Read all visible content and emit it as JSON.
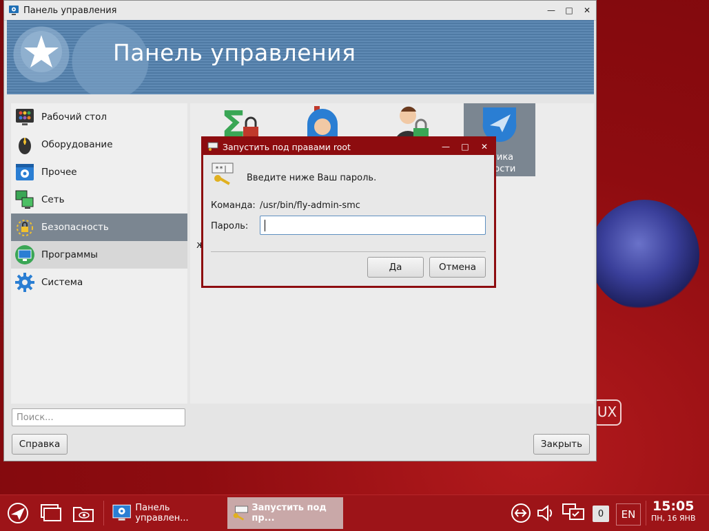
{
  "main_window": {
    "title": "Панель управления",
    "banner_title": "Панель управления",
    "sidebar": [
      {
        "label": "Рабочий стол",
        "icon": "desktop-icon"
      },
      {
        "label": "Оборудование",
        "icon": "mouse-icon"
      },
      {
        "label": "Прочее",
        "icon": "window-gear-icon"
      },
      {
        "label": "Сеть",
        "icon": "network-icon"
      },
      {
        "label": "Безопасность",
        "icon": "security-lock-icon",
        "selected": true
      },
      {
        "label": "Программы",
        "icon": "monitor-icon"
      },
      {
        "label": "Система",
        "icon": "gear-icon"
      }
    ],
    "content_tiles": [
      {
        "icon": "sigma-lock-icon"
      },
      {
        "icon": "user-badge-icon"
      },
      {
        "icon": "user-lock-icon"
      },
      {
        "icon": "policy-shield-icon",
        "label_line1": "итика",
        "label_line2": "сности"
      }
    ],
    "stray_char": "ж",
    "search_placeholder": "Поиск...",
    "help_button": "Справка",
    "close_button": "Закрыть"
  },
  "dialog": {
    "title": "Запустить под правами root",
    "prompt": "Введите ниже Ваш пароль.",
    "command_label": "Команда:",
    "command_value": "/usr/bin/fly-admin-smc",
    "password_label": "Пароль:",
    "password_value": "",
    "ok_button": "Да",
    "cancel_button": "Отмена"
  },
  "desktop": {
    "logo_text": "UX"
  },
  "taskbar": {
    "tasks": [
      {
        "label": "Панель управлен...",
        "icon": "control-panel-icon"
      },
      {
        "label": "Запустить под пр...",
        "icon": "keys-icon",
        "active": true
      }
    ],
    "tray": {
      "notifications_count": "0",
      "keyboard_layout": "EN",
      "time": "15:05",
      "date": "ПН, 16 ЯНВ"
    }
  },
  "colors": {
    "desktop_red": "#8e0c10",
    "dialog_border": "#8d0c0f",
    "selected_item": "#7b8691",
    "banner_blue": "#5f8ab4"
  }
}
